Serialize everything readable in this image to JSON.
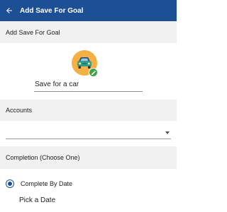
{
  "appbar": {
    "title": "Add Save For Goal",
    "back_icon": "back-arrow-icon",
    "background": "#1c4f94"
  },
  "sections": {
    "goal_header": "Add Save For Goal",
    "accounts_header": "Accounts",
    "completion_header": "Completion (Choose One)"
  },
  "goal": {
    "icon": "car-icon",
    "icon_background": "#f4b043",
    "edit_icon": "pencil-icon",
    "edit_badge_color": "#43a047",
    "name_value": "Save for a car"
  },
  "accounts": {
    "selected_value": "",
    "dropdown_icon": "dropdown-arrow-icon"
  },
  "completion": {
    "options": [
      {
        "label": "Complete By Date",
        "selected": true
      }
    ],
    "pick_date_label": "Pick a Date"
  }
}
